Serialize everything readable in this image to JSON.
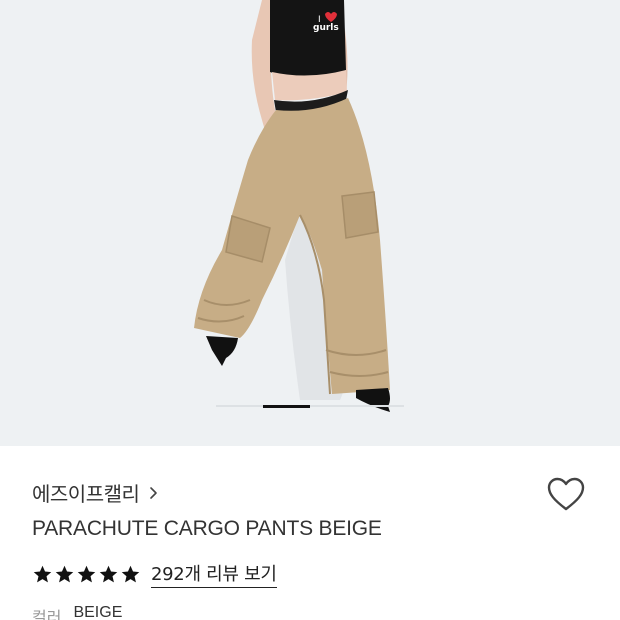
{
  "product": {
    "brand": "에즈이프캘리",
    "name": "PARACHUTE CARGO PANTS BEIGE",
    "rating_stars": 5,
    "reviews_link": "292개 리뷰 보기",
    "color_label": "컬러",
    "color_value": "BEIGE",
    "tank_print_top": "I",
    "tank_print_bottom": "gurls"
  },
  "gallery": {
    "current_index": 1,
    "total": 4
  },
  "colors": {
    "hero_bg": "#eef1f3",
    "pants": "#c7ad86",
    "top": "#141414",
    "star": "#111111"
  },
  "icons": {
    "brand_chevron": "chevron-right-icon",
    "wishlist": "heart-outline-icon",
    "rating": "star-icon"
  }
}
